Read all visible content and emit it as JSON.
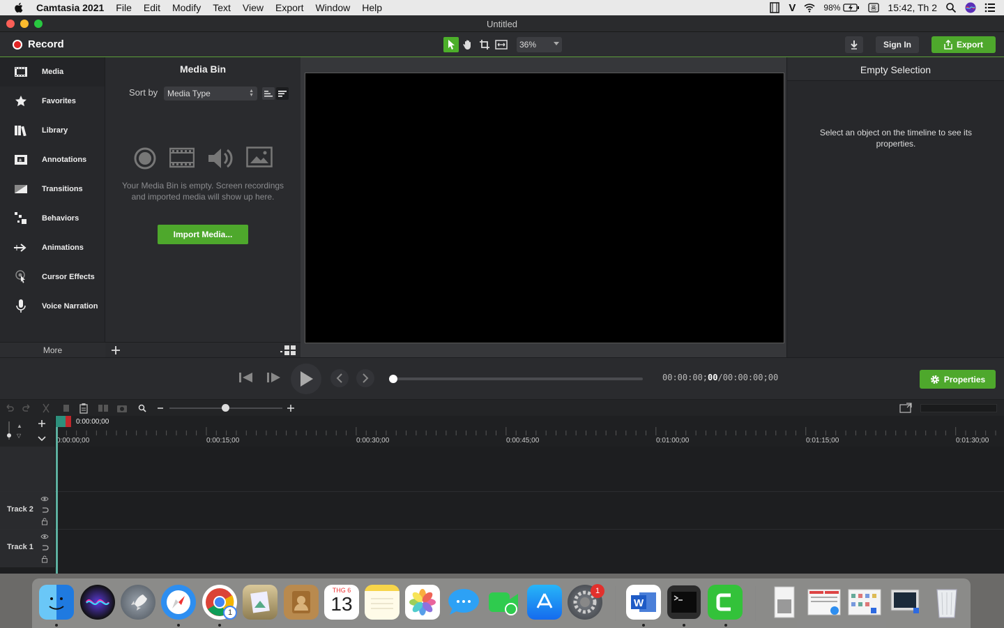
{
  "menubar": {
    "app_name": "Camtasia 2021",
    "items": [
      "File",
      "Edit",
      "Modify",
      "Text",
      "View",
      "Export",
      "Window",
      "Help"
    ],
    "battery": "98%",
    "clock": "15:42, Th 2"
  },
  "window": {
    "title": "Untitled"
  },
  "toolbar": {
    "record_label": "Record",
    "zoom": "36%",
    "sign_in": "Sign In",
    "export": "Export"
  },
  "sidebar": {
    "items": [
      {
        "label": "Media",
        "icon": "film-strip-icon"
      },
      {
        "label": "Favorites",
        "icon": "star-icon"
      },
      {
        "label": "Library",
        "icon": "books-icon"
      },
      {
        "label": "Annotations",
        "icon": "annotation-icon"
      },
      {
        "label": "Transitions",
        "icon": "transition-icon"
      },
      {
        "label": "Behaviors",
        "icon": "behaviors-icon"
      },
      {
        "label": "Animations",
        "icon": "animation-arrow-icon"
      },
      {
        "label": "Cursor Effects",
        "icon": "cursor-icon"
      },
      {
        "label": "Voice Narration",
        "icon": "microphone-icon"
      }
    ],
    "more": "More"
  },
  "media_bin": {
    "title": "Media Bin",
    "sort_label": "Sort by",
    "sort_value": "Media Type",
    "empty_message": "Your Media Bin is empty. Screen recordings and imported media will show up here.",
    "import_button": "Import Media..."
  },
  "properties": {
    "title": "Empty Selection",
    "message": "Select an object on the timeline to see its properties.",
    "button": "Properties"
  },
  "playback": {
    "current_time_prefix": "00:00:00;",
    "current_time_frames": "00",
    "total_time": "/00:00:00;00"
  },
  "timeline": {
    "playhead_time": "0:00:00;00",
    "ticks": [
      "0:00:00;00",
      "0:00:15;00",
      "0:00:30;00",
      "0:00:45;00",
      "0:01:00;00",
      "0:01:15;00",
      "0:01:30;00"
    ],
    "tracks": [
      "Track 2",
      "Track 1"
    ]
  },
  "dock": {
    "apps": [
      "Finder",
      "Siri",
      "Launchpad",
      "Safari",
      "Chrome",
      "Preview",
      "Contacts",
      "Calendar",
      "Notes",
      "Photos",
      "Messages",
      "FaceTime",
      "App Store",
      "System Preferences",
      "Word",
      "Terminal",
      "Camtasia",
      "Downloads",
      "Documents",
      "Applications",
      "Desktop",
      "Trash"
    ],
    "calendar_month": "THG 6",
    "calendar_day": "13",
    "chrome_badge": "1",
    "syspref_badge": "1"
  },
  "colors": {
    "accent_green": "#4ea82c",
    "record_red": "#e02424",
    "playhead_teal": "#2d8f7c"
  }
}
